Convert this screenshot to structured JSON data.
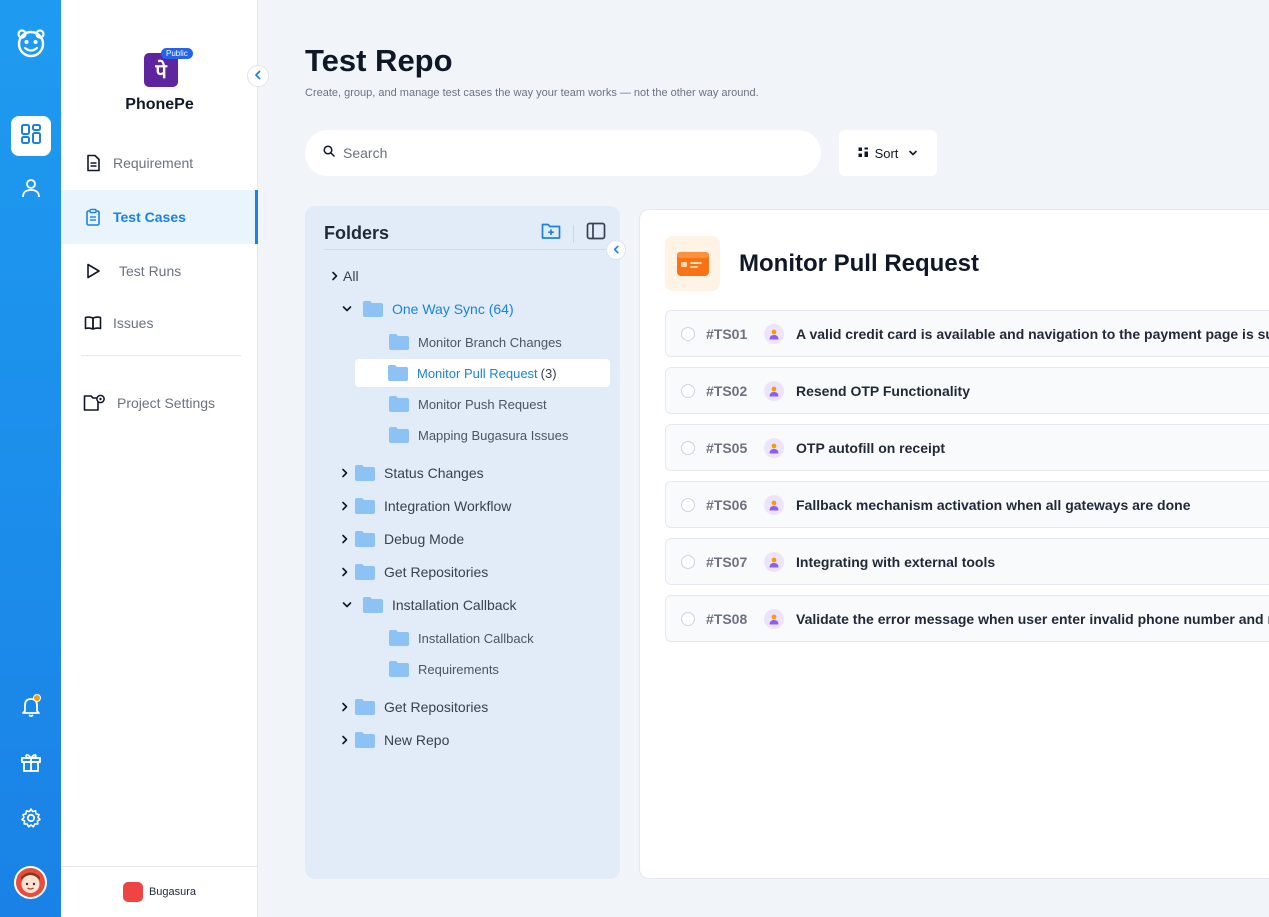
{
  "brand": {
    "name": "PhonePe",
    "logo_glyph": "पे",
    "badge": "Public",
    "color": "#5f259f"
  },
  "page": {
    "title": "Test Repo",
    "subtitle": "Create, group, and manage test cases the way your team works — not the other way around."
  },
  "search": {
    "placeholder": "Search"
  },
  "sort": {
    "label": "Sort"
  },
  "sidebar": {
    "items": [
      {
        "label": "Requirement",
        "icon": "document-icon"
      },
      {
        "label": "Test Cases",
        "icon": "clipboard-icon",
        "active": true
      },
      {
        "label": "Test Runs",
        "icon": "play-icon"
      },
      {
        "label": "Issues",
        "icon": "book-icon"
      },
      {
        "label": "Project Settings",
        "icon": "folder-gear-icon"
      }
    ],
    "footer": "Bugasura"
  },
  "folders": {
    "title": "Folders",
    "tree": {
      "all": "All",
      "one_way_sync": "One Way Sync (64)",
      "monitor_branch": "Monitor Branch Changes",
      "monitor_pull": "Monitor Pull Request",
      "monitor_pull_count": "(3)",
      "monitor_push": "Monitor Push Request",
      "mapping": "Mapping Bugasura Issues",
      "status_changes": "Status Changes",
      "integration_workflow": "Integration Workflow",
      "debug_mode": "Debug Mode",
      "get_repos_1": "Get Repositories",
      "installation_callback": "Installation Callback",
      "installation_callback_sub": "Installation Callback",
      "requirements": "Requirements",
      "get_repos_2": "Get Repositories",
      "new_repo": "New Repo"
    }
  },
  "cases": {
    "title": "Monitor Pull Request",
    "rows": [
      {
        "id": "#TS01",
        "title": "A valid credit card is available and navigation to the payment page is suc"
      },
      {
        "id": "#TS02",
        "title": "Resend OTP Functionality"
      },
      {
        "id": "#TS05",
        "title": "OTP autofill on receipt"
      },
      {
        "id": "#TS06",
        "title": "Fallback mechanism activation when all gateways are done"
      },
      {
        "id": "#TS07",
        "title": "Integrating with external tools"
      },
      {
        "id": "#TS08",
        "title": "Validate the error message when user enter invalid phone number and re"
      }
    ]
  },
  "colors": {
    "accent": "#1a82e6",
    "rail": "#1e9bf0",
    "folder": "#8cc2f4",
    "notification": "#f59e0b"
  }
}
